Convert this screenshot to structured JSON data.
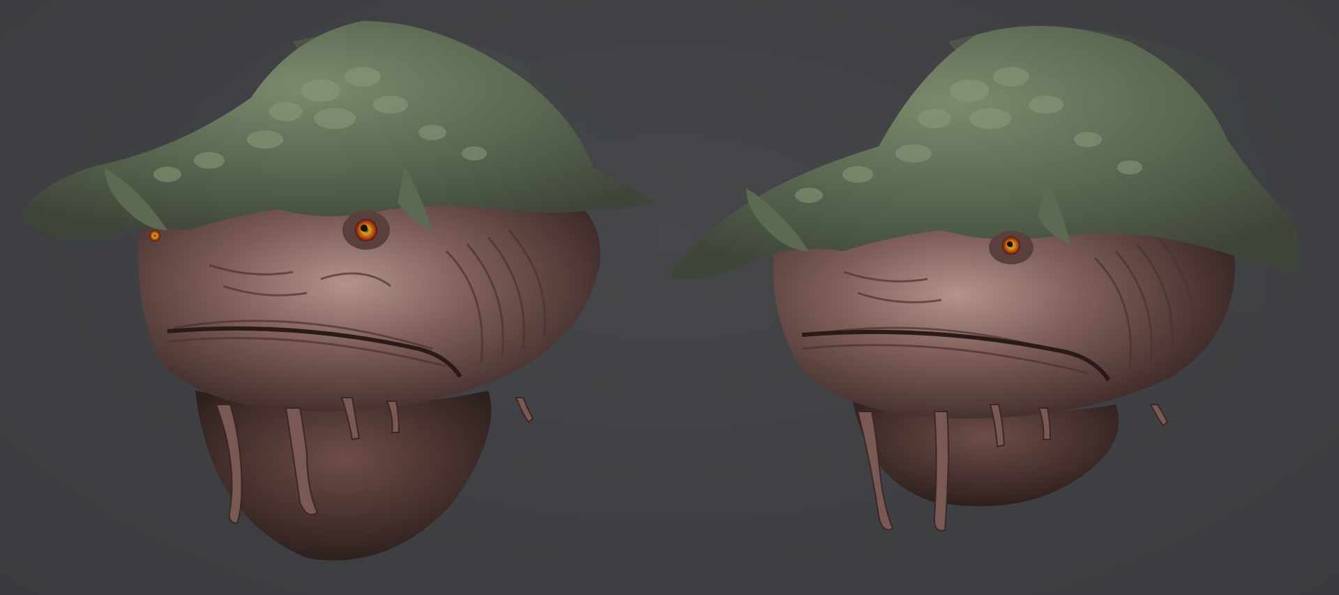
{
  "scene": {
    "background_color": "#3f4144",
    "views": [
      {
        "name": "creature-head-left",
        "skin_color": "#8a6660",
        "plate_color": "#5d6a52",
        "eye_color": "#d9a623"
      },
      {
        "name": "creature-head-right",
        "skin_color": "#8a6660",
        "plate_color": "#5d6a52",
        "eye_color": "#d9a623"
      }
    ]
  }
}
